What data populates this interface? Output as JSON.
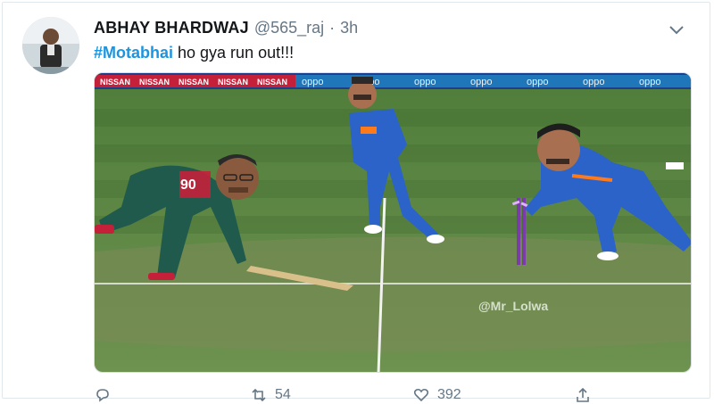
{
  "tweet": {
    "author": {
      "display_name": "ABHAY BHARDWAJ",
      "handle": "@565_raj",
      "separator": "·",
      "time": "3h",
      "avatar": "profile-photo"
    },
    "text": {
      "hashtag": "#Motabhai",
      "body": " ho gya run out!!!"
    },
    "media": {
      "description_icon": "cricket-run-out-meme-image",
      "watermark": "@Mr_Lolwa",
      "jersey_number": "90",
      "billboard_left": [
        "NISSAN",
        "NISSAN",
        "NISSAN",
        "NISSAN",
        "NISSAN"
      ],
      "billboard_right": [
        "oppo",
        "oppo",
        "oppo",
        "oppo",
        "oppo",
        "oppo",
        "oppo"
      ],
      "colors": {
        "pitch_green": "#5e8a45",
        "india_blue": "#2c63c9",
        "bangladesh_green": "#1f5a4d",
        "banner_red": "#c4203a",
        "banner_blue": "#1f76b8"
      }
    },
    "actions": {
      "reply_icon": "reply-icon",
      "retweet_icon": "retweet-icon",
      "retweet_count": "54",
      "like_icon": "heart-icon",
      "like_count": "392",
      "share_icon": "share-icon"
    },
    "menu_icon": "chevron-down-icon"
  }
}
